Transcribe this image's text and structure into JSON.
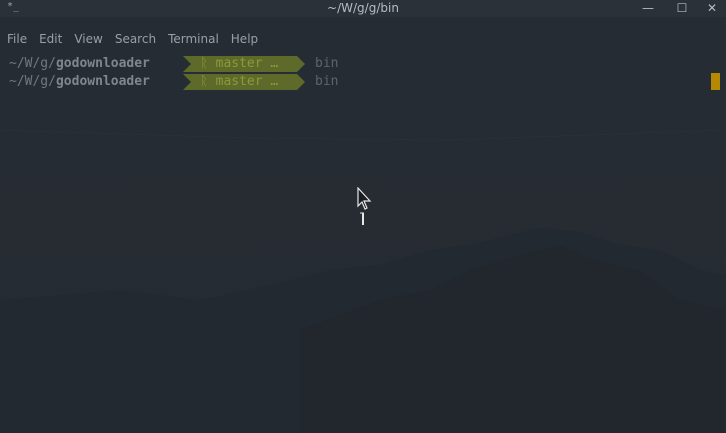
{
  "window": {
    "title": "~/W/g/g/bin",
    "icon_glyph": "*_",
    "minimize_glyph": "—",
    "maximize_glyph": "☐",
    "close_glyph": "✕"
  },
  "menu": {
    "items": [
      {
        "label": "File"
      },
      {
        "label": "Edit"
      },
      {
        "label": "View"
      },
      {
        "label": "Search"
      },
      {
        "label": "Terminal"
      },
      {
        "label": "Help"
      }
    ]
  },
  "terminal": {
    "lines": [
      {
        "path_prefix": "~/W/g/",
        "path_dir": "godownloader",
        "git_branch": "ᚱ master …",
        "cwd": "bin"
      },
      {
        "path_prefix": "~/W/g/",
        "path_dir": "godownloader",
        "git_branch": "ᚱ master …",
        "cwd": "bin"
      }
    ]
  },
  "icons": {
    "terminal_icon": "terminal-icon",
    "pointer": "mouse-pointer-icon",
    "git_branch": "git-branch-icon"
  },
  "colors": {
    "background": "#262c33",
    "git_segment": "#5d6a2a",
    "git_text": "#8a9a3a",
    "cursor": "#b58900",
    "path_text": "#7e878f"
  }
}
